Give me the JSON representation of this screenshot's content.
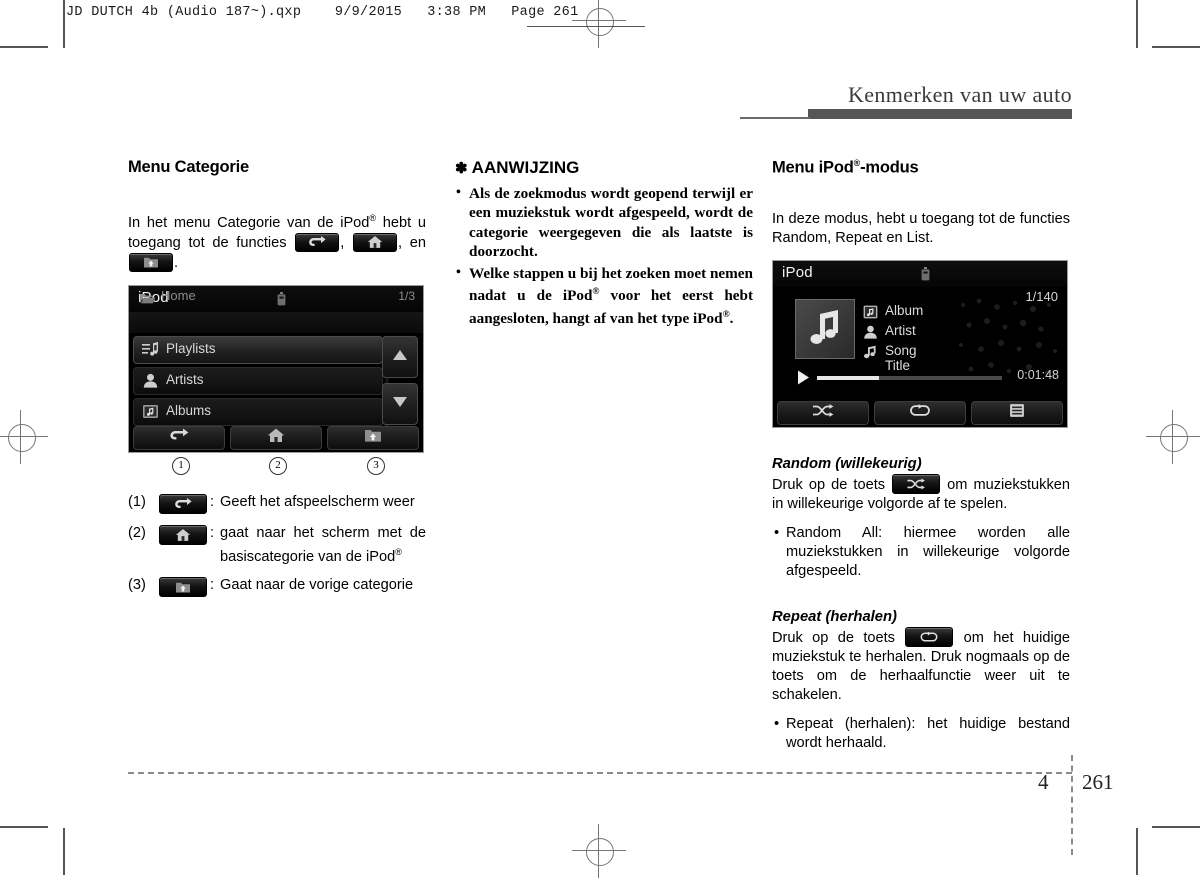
{
  "print_header": {
    "text": "JD DUTCH 4b (Audio 187~).qxp    9/9/2015   3:38 PM   Page 261"
  },
  "running_head": {
    "title": "Kenmerken van uw auto"
  },
  "footer": {
    "chapter": "4",
    "page": "261"
  },
  "left_column": {
    "heading": "Menu Categorie",
    "intro_part1": "In het menu Categorie van de iPod",
    "intro_sup1": "®",
    "intro_part2": " hebt u toegang tot de functies ",
    "intro_part3": ", ",
    "intro_part4": ", en ",
    "intro_part5": ".",
    "device": {
      "title": "iPod",
      "breadcrumb": "Home",
      "page_count": "1/3",
      "rows": [
        {
          "label": "Playlists",
          "icon": "playlist-icon"
        },
        {
          "label": "Artists",
          "icon": "artist-icon"
        },
        {
          "label": "Albums",
          "icon": "album-icon"
        }
      ],
      "buttons": [
        {
          "name": "back-button",
          "icon": "back-arrow-icon"
        },
        {
          "name": "home-button",
          "icon": "home-icon"
        },
        {
          "name": "folder-up-button",
          "icon": "folder-up-icon"
        }
      ]
    },
    "callouts": [
      "1",
      "2",
      "3"
    ],
    "legend": [
      {
        "num": "(1)",
        "icon": "back-arrow-icon",
        "colon": ":",
        "text": "Geeft het afspeelscherm weer",
        "sup": ""
      },
      {
        "num": "(2)",
        "icon": "home-icon",
        "colon": ":",
        "text": "gaat naar het scherm met de basiscategorie van de iPod",
        "sup": "®"
      },
      {
        "num": "(3)",
        "icon": "folder-up-icon",
        "colon": ":",
        "text": "Gaat naar de vorige categorie",
        "sup": ""
      }
    ]
  },
  "middle_column": {
    "note_star": "✽",
    "note_title": "AANWIJZING",
    "notes": [
      {
        "text": "Als de zoekmodus wordt geopend terwijl er een muziekstuk wordt afgespeeld, wordt de categorie weergegeven die als laatste is doorzocht.",
        "sup": ""
      },
      {
        "text_a": "Welke stappen u bij het zoeken moet nemen nadat u de iPod",
        "sup_a": "®",
        "text_b": " voor het eerst hebt aangesloten, hangt af van het type iPod",
        "sup_b": "®",
        "text_c": "."
      }
    ]
  },
  "right_column": {
    "heading_part1": "Menu iPod",
    "heading_sup": "®",
    "heading_part2": "-modus",
    "intro": "In deze modus, hebt u toegang tot de functies Random, Repeat en List.",
    "device": {
      "title": "iPod",
      "track_count": "1/140",
      "meta": [
        {
          "label": "Album",
          "icon": "album-icon"
        },
        {
          "label": "Artist",
          "icon": "artist-icon"
        },
        {
          "label": "Song Title",
          "icon": "song-icon"
        }
      ],
      "elapsed_time": "0:01:48",
      "buttons": [
        {
          "name": "shuffle-button",
          "icon": "shuffle-icon"
        },
        {
          "name": "repeat-button",
          "icon": "repeat-icon"
        },
        {
          "name": "list-button",
          "icon": "list-icon"
        }
      ]
    },
    "random": {
      "heading": "Random (willekeurig)",
      "text_before": "Druk op de toets ",
      "text_after": " om muziekstukken in willekeurige volgorde af te spelen.",
      "bullets": [
        "Random All: hiermee worden alle muziekstukken in willekeurige volgorde afgespeeld."
      ]
    },
    "repeat": {
      "heading": "Repeat (herhalen)",
      "text_before": "Druk op de toets ",
      "text_after": " om het huidige muziekstuk te herhalen. Druk nogmaals op de toets om de herhaalfunctie weer uit te schakelen.",
      "bullets": [
        "Repeat (herhalen): het huidige bestand wordt herhaald."
      ]
    }
  },
  "colors": {
    "head_bar": "#555555",
    "screen_bg": "#000000",
    "text": "#000000"
  }
}
